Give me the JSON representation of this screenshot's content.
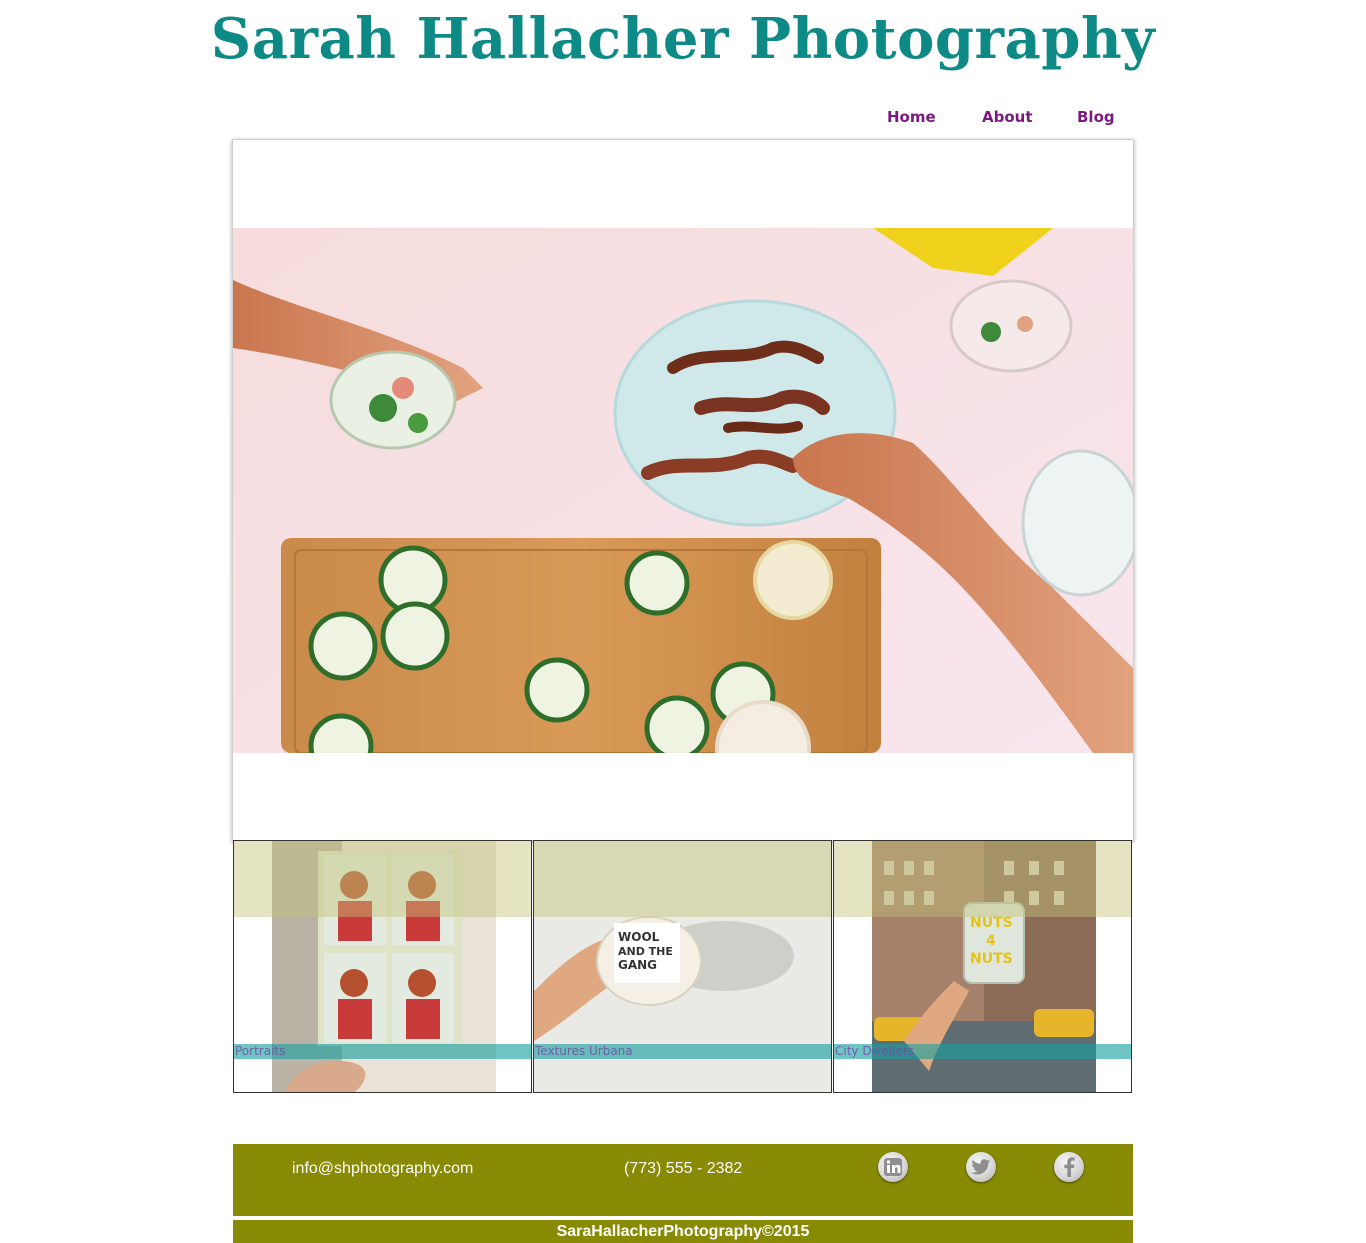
{
  "site": {
    "title": "Sarah Hallacher Photography"
  },
  "nav": {
    "items": [
      "Home",
      "About",
      "Blog"
    ]
  },
  "gallery": {
    "tiles": [
      {
        "label": "Portraits"
      },
      {
        "label": "Textures Urbana"
      },
      {
        "label": "City Dwellers"
      }
    ]
  },
  "footer": {
    "email": "info@shphotography.com",
    "phone": "(773) 555 - 2382",
    "social": [
      "linkedin-icon",
      "twitter-icon",
      "facebook-icon"
    ],
    "copyright": "SaraHallacherPhotography©2015"
  },
  "colors": {
    "title": "#0e8a86",
    "nav": "#7a1a7e",
    "footer": "#878a02"
  }
}
